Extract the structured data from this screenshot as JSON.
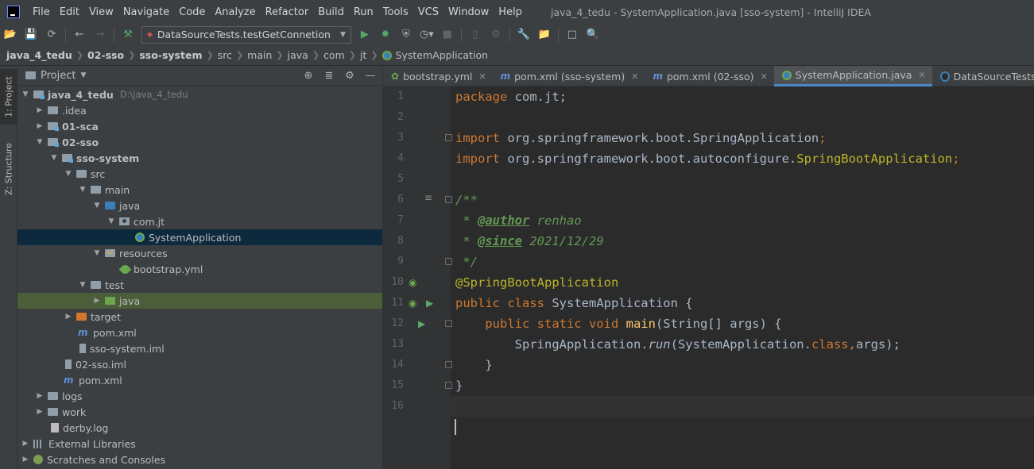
{
  "menubar": {
    "items": [
      "File",
      "Edit",
      "View",
      "Navigate",
      "Code",
      "Analyze",
      "Refactor",
      "Build",
      "Run",
      "Tools",
      "VCS",
      "Window",
      "Help"
    ],
    "window_title": "java_4_tedu - SystemApplication.java [sso-system] - IntelliJ IDEA"
  },
  "toolbar": {
    "run_config": "DataSourceTests.testGetConnetion"
  },
  "breadcrumb": [
    "java_4_tedu",
    "02-sso",
    "sso-system",
    "src",
    "main",
    "java",
    "com",
    "jt",
    "SystemApplication"
  ],
  "sidebar": {
    "project_tab": "1: Project",
    "structure_tab": "Z: Structure"
  },
  "project_panel": {
    "title": "Project",
    "tree": [
      {
        "label": "java_4_tedu",
        "path": "D:\\java_4_tedu"
      },
      {
        "label": ".idea"
      },
      {
        "label": "01-sca"
      },
      {
        "label": "02-sso"
      },
      {
        "label": "sso-system"
      },
      {
        "label": "src"
      },
      {
        "label": "main"
      },
      {
        "label": "java"
      },
      {
        "label": "com.jt"
      },
      {
        "label": "SystemApplication"
      },
      {
        "label": "resources"
      },
      {
        "label": "bootstrap.yml"
      },
      {
        "label": "test"
      },
      {
        "label": "java"
      },
      {
        "label": "target"
      },
      {
        "label": "pom.xml"
      },
      {
        "label": "sso-system.iml"
      },
      {
        "label": "02-sso.iml"
      },
      {
        "label": "pom.xml"
      },
      {
        "label": "logs"
      },
      {
        "label": "work"
      },
      {
        "label": "derby.log"
      },
      {
        "label": "External Libraries"
      },
      {
        "label": "Scratches and Consoles"
      }
    ]
  },
  "editor": {
    "tabs": [
      {
        "label": "bootstrap.yml",
        "icon": "spring-leaf-icon"
      },
      {
        "label": "pom.xml (sso-system)",
        "icon": "maven-icon"
      },
      {
        "label": "pom.xml (02-sso)",
        "icon": "maven-icon"
      },
      {
        "label": "SystemApplication.java",
        "icon": "spring-class-icon",
        "active": true
      },
      {
        "label": "DataSourceTests.java",
        "icon": "class-icon"
      }
    ],
    "line_numbers": [
      "1",
      "2",
      "3",
      "4",
      "5",
      "6",
      "7",
      "8",
      "9",
      "10",
      "11",
      "12",
      "13",
      "14",
      "15",
      "16"
    ],
    "code": {
      "l1_kw": "package ",
      "l1_rest": "com.jt;",
      "l3_kw": "import ",
      "l3_rest": "org.springframework.boot.SpringApplication",
      "l4_kw": "import ",
      "l4_pkg": "org.springframework.boot.autoconfigure.",
      "l4_cls": "SpringBootApplication",
      "semi": ";",
      "l6": "/**",
      "l7_star": " * ",
      "l7_tag": "@author",
      "l7_val": " renhao",
      "l8_star": " * ",
      "l8_tag": "@since",
      "l8_val": " 2021/12/29",
      "l9": " */",
      "l10": "@SpringBootApplication",
      "l11_kw": "public class ",
      "l11_rest": "SystemApplication {",
      "l12_indent": "    ",
      "l12_kw": "public static void ",
      "l12_fn": "main",
      "l12_rest": "(String[] args) {",
      "l13_indent": "        ",
      "l13_a": "SpringApplication.",
      "l13_run": "run",
      "l13_b": "(SystemApplication.",
      "l13_kw": "class,",
      "l13_c": "args);",
      "l14": "    }",
      "l15": "}"
    }
  }
}
